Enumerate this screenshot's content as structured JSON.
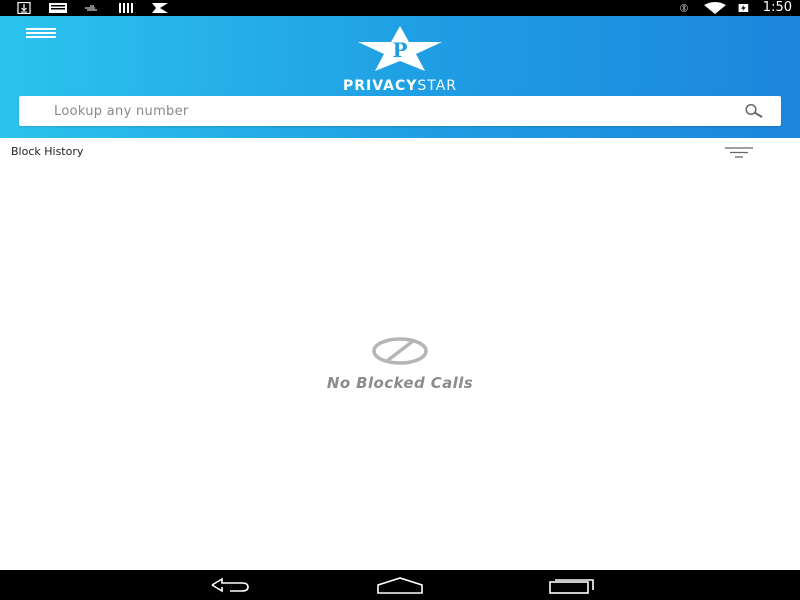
{
  "status_bar": {
    "time": "1:50",
    "left_icons": [
      "download-icon",
      "keyboard-icon",
      "signal-strength-icon",
      "sim-card-icon",
      "send-icon"
    ],
    "right_icons": [
      "bluetooth-icon",
      "wifi-icon",
      "battery-charging-icon"
    ]
  },
  "header": {
    "menu_icon": "hamburger-menu-icon",
    "logo": {
      "star_letter": "P",
      "text_bold": "PRIVACY",
      "text_light": "STAR"
    },
    "search": {
      "placeholder": "Lookup any number",
      "value": "",
      "icon": "search-icon"
    },
    "colors": {
      "gradient_start": "#2cc3ee",
      "gradient_end": "#1d86dd"
    }
  },
  "history": {
    "title": "Block History",
    "filter_icon": "filter-icon"
  },
  "empty_state": {
    "icon": "block-icon",
    "message": "No Blocked Calls"
  },
  "nav_bar": {
    "buttons": [
      "back-icon",
      "home-icon",
      "recent-apps-icon"
    ]
  }
}
